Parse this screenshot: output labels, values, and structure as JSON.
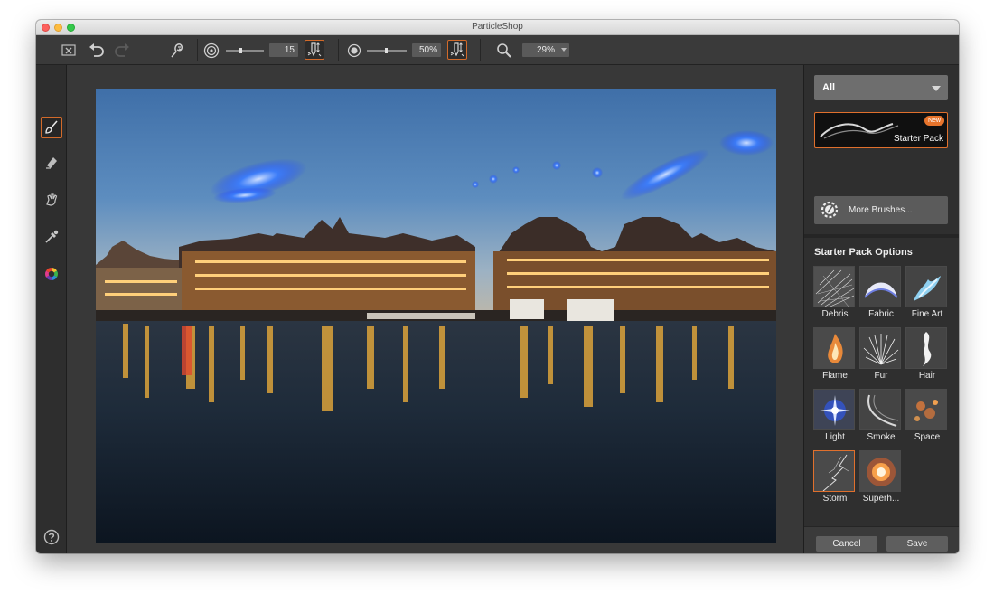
{
  "window": {
    "title": "ParticleShop"
  },
  "toolbar": {
    "size_value": "15",
    "opacity_value": "50%",
    "zoom_value": "29%"
  },
  "sidebar": {
    "brush_filter": "All",
    "brush_pack": {
      "name": "Starter Pack",
      "badge": "New"
    },
    "more_brushes_label": "More Brushes...",
    "options_title": "Starter Pack Options",
    "brushes": [
      {
        "label": "Debris"
      },
      {
        "label": "Fabric"
      },
      {
        "label": "Fine Art"
      },
      {
        "label": "Flame"
      },
      {
        "label": "Fur"
      },
      {
        "label": "Hair"
      },
      {
        "label": "Light"
      },
      {
        "label": "Smoke"
      },
      {
        "label": "Space"
      },
      {
        "label": "Storm"
      },
      {
        "label": "Superh..."
      }
    ]
  },
  "footer": {
    "cancel_label": "Cancel",
    "save_label": "Save"
  },
  "colors": {
    "accent": "#e0702d",
    "particle_blue": "#2a6dff"
  }
}
